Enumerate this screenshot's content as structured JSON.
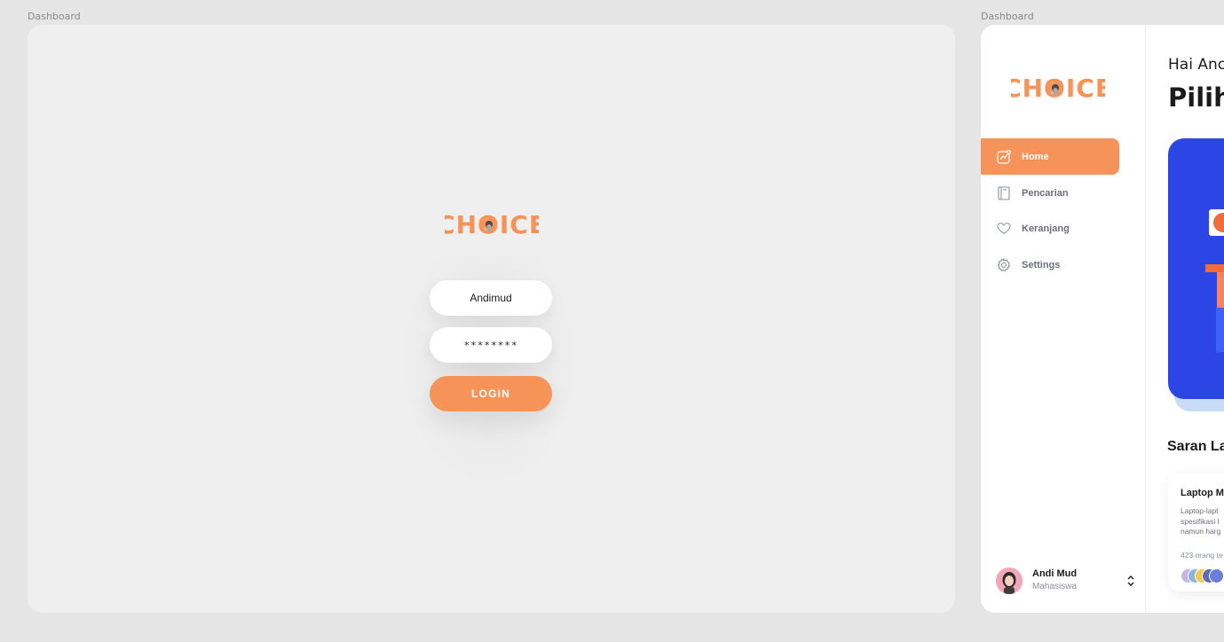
{
  "frames": {
    "left_label": "Dashboard",
    "right_label": "Dashboard"
  },
  "brand": {
    "name": "CHOICE",
    "accent": "#f59358"
  },
  "login": {
    "username_value": "Andimud",
    "password_value": "********",
    "login_label": "LOGIN"
  },
  "sidebar": {
    "items": [
      {
        "label": "Home",
        "icon": "chart-icon",
        "active": true
      },
      {
        "label": "Pencarian",
        "icon": "book-icon",
        "active": false
      },
      {
        "label": "Keranjang",
        "icon": "heart-icon",
        "active": false
      },
      {
        "label": "Settings",
        "icon": "gear-icon",
        "active": false
      }
    ]
  },
  "profile": {
    "name": "Andi Mud",
    "role": "Mahasiswa"
  },
  "main": {
    "greeting": "Hai Anc",
    "headline": "Pilih",
    "banner_color": "#2c46e5",
    "section_title": "Saran La",
    "card": {
      "title": "Laptop M",
      "description": "Laptop-lapt\nspesifikasi l\nnamun harg",
      "count": "423 orang te"
    }
  }
}
